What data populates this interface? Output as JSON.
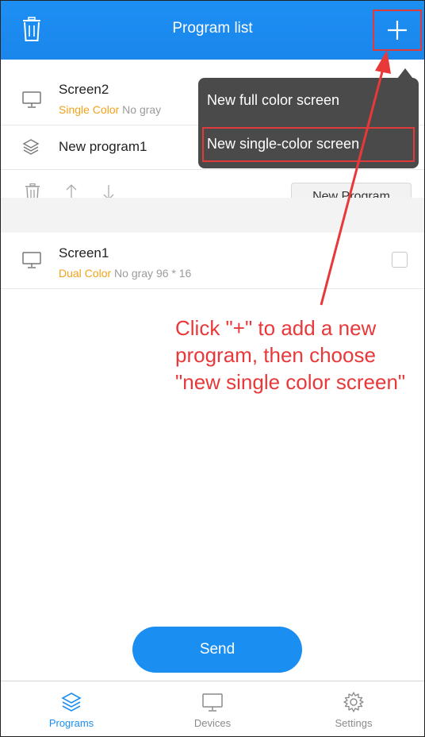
{
  "header": {
    "title": "Program list"
  },
  "program_list": {
    "screen2": {
      "name": "Screen2",
      "color": "Single Color",
      "gray": "No gray"
    },
    "program1": {
      "name": "New program1"
    },
    "new_program_label": "New Program",
    "screen1": {
      "name": "Screen1",
      "color": "Dual Color",
      "gray": "No gray",
      "size": "96 * 16"
    }
  },
  "menu": {
    "items": [
      {
        "label": "New full color screen"
      },
      {
        "label": "New single-color screen"
      }
    ]
  },
  "annotation": {
    "text": "Click \"+\" to add a new\nprogram, then choose\n\"new single color screen\""
  },
  "send_label": "Send",
  "tabs": [
    {
      "label": "Programs",
      "icon": "layers-icon",
      "active": true
    },
    {
      "label": "Devices",
      "icon": "monitor-icon",
      "active": false
    },
    {
      "label": "Settings",
      "icon": "gear-icon",
      "active": false
    }
  ],
  "colors": {
    "accent": "#1b8ef2",
    "header": "#1a86ec",
    "highlight": "#e03a3a",
    "color_label": "#f3a21b",
    "menu_bg": "#4a4a4a"
  }
}
